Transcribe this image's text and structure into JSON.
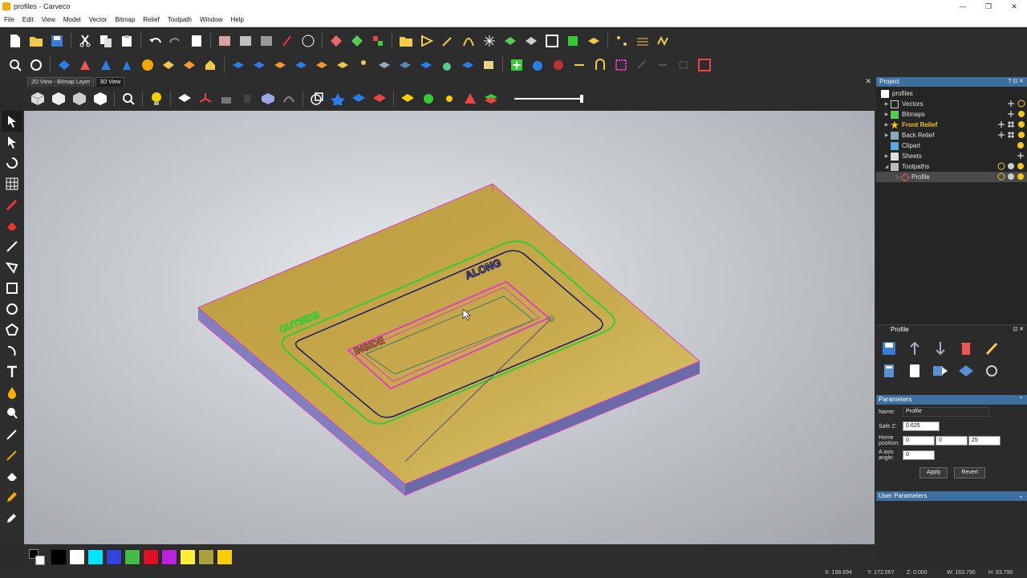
{
  "window": {
    "title": "profiles - Carveco",
    "minimize": "—",
    "maximize": "❐",
    "close": "✕"
  },
  "menu": [
    "File",
    "Edit",
    "View",
    "Model",
    "Vector",
    "Bitmap",
    "Relief",
    "Toolpath",
    "Window",
    "Help"
  ],
  "view_tabs": {
    "tab_2d": "2D View - Bitmap Layer",
    "tab_3d": "3D View",
    "close": "✕"
  },
  "project": {
    "header": "Project",
    "header_ctl": "? ⊡ ✕",
    "root": "profiles",
    "items": [
      {
        "label": "Vectors"
      },
      {
        "label": "Bitmaps"
      },
      {
        "label": "Front Relief"
      },
      {
        "label": "Back Relief"
      },
      {
        "label": "Clipart"
      },
      {
        "label": "Sheets"
      },
      {
        "label": "Toolpaths"
      },
      {
        "label": "Profile"
      }
    ]
  },
  "profile_panel": {
    "header": "Profile",
    "header_ctl": "⊡ ✕",
    "params_header": "Parameters",
    "name_label": "Name:",
    "name_value": "Profile",
    "safez_label": "Safe Z:",
    "safez_value": "0.625",
    "home_label": "Home position:",
    "home_x": "0",
    "home_y": "0",
    "home_z": "25",
    "aaxis_label": "A axis angle:",
    "aaxis_value": "0",
    "apply": "Apply",
    "revert": "Revert",
    "user_params": "User Parameters"
  },
  "viewport_text": {
    "outside": "OUTSIDE",
    "inside": "INSIDE",
    "along": "ALONG"
  },
  "status": {
    "x": "X: 198.894",
    "y": "Y: 172.067",
    "z": "Z: 0.000",
    "w": "W: 163.790",
    "h": "H: 63.790"
  },
  "colors": {
    "accent": "#3f6f9f",
    "material": "#c9a94a",
    "side": "#7b7bb8",
    "outside": "#33cc33",
    "inside": "#e040c0",
    "along": "#1a1a66"
  },
  "palette": [
    "#000000",
    "#ffffff",
    "#00e5ff",
    "#3344dd",
    "#44bb44",
    "#dd1122",
    "#bb22dd",
    "#ffee33",
    "#aaa040",
    "#ffcc00"
  ]
}
